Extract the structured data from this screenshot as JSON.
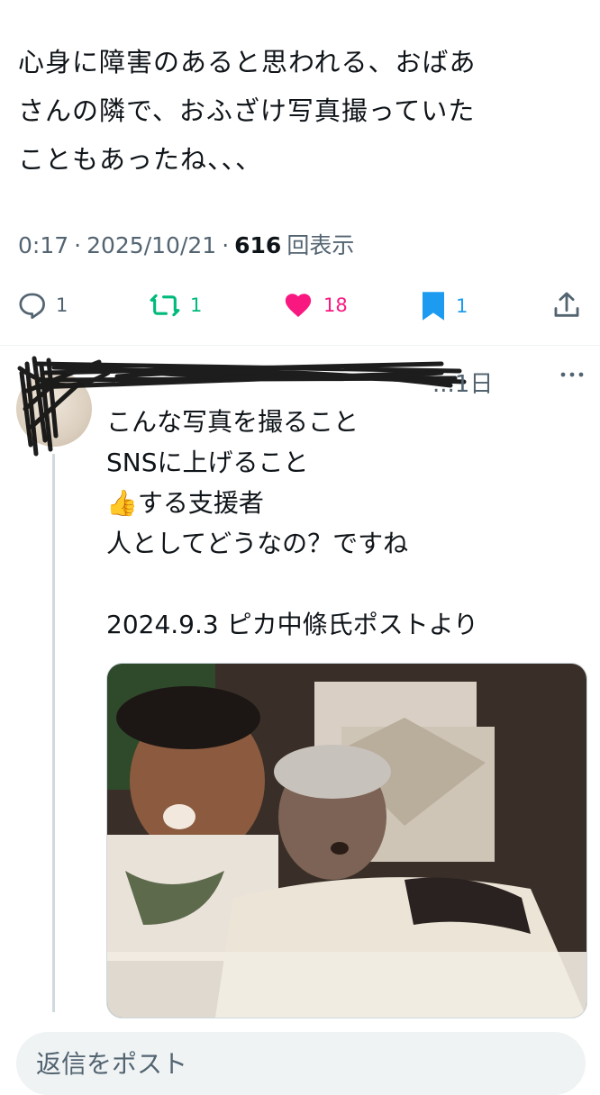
{
  "post": {
    "text": "心身に障害のあると思われる、おばあ\nさんの隣で、おふざけ写真撮っていた\nこともあったね、、、",
    "time": "0:17",
    "sep1": "·",
    "date": "2025/10/21",
    "sep2": "·",
    "views": "616",
    "views_label": "回表示"
  },
  "actions": {
    "reply_count": "1",
    "repost_count": "1",
    "like_count": "18",
    "bookmark_count": "1",
    "icons": [
      "reply-icon",
      "repost-icon",
      "like-icon",
      "bookmark-icon",
      "share-icon"
    ],
    "colors": {
      "repost": "#00ba7c",
      "like": "#f91880",
      "bookmark": "#1d9bf0"
    }
  },
  "reply": {
    "handle_tail": "...",
    "time": "1日",
    "text": "こんな写真を撮ること\nSNSに上げること\n👍する支援者\n人としてどうなの？ですね\n\n2024.9.3 ピカ中條氏ポストより"
  },
  "composer": {
    "placeholder": "返信をポスト"
  }
}
